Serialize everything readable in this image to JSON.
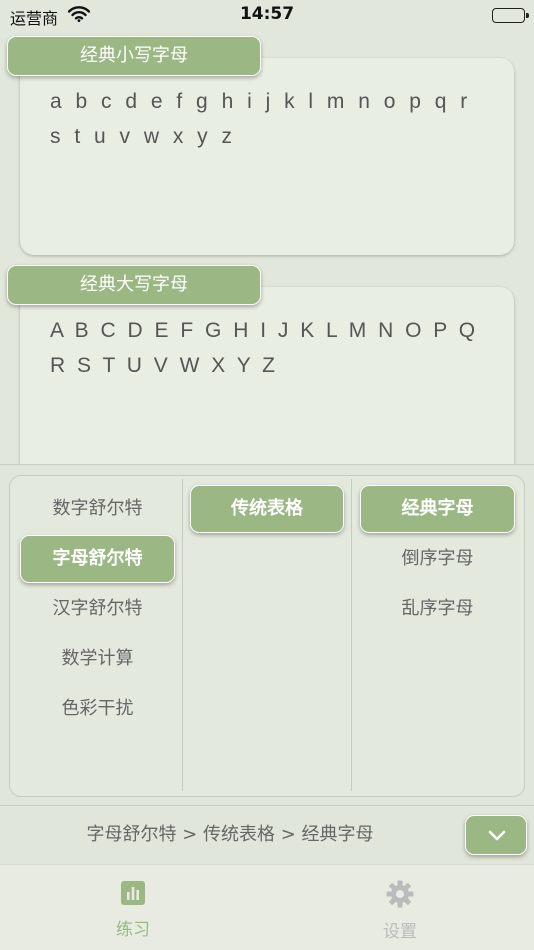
{
  "status_bar": {
    "carrier": "运营商",
    "time": "14:57"
  },
  "sections": [
    {
      "title": "经典小写字母",
      "letters": "a b c d e f g h i j k l m n o p q r s t u v w x y z"
    },
    {
      "title": "经典大写字母",
      "letters": "A B C D E F G H I J K L M N O P Q R S T U V W X Y Z"
    }
  ],
  "picker": {
    "col1": [
      "数字舒尔特",
      "字母舒尔特",
      "汉字舒尔特",
      "数学计算",
      "色彩干扰"
    ],
    "col2": [
      "传统表格"
    ],
    "col3": [
      "经典字母",
      "倒序字母",
      "乱序字母"
    ]
  },
  "breadcrumb": "字母舒尔特 > 传统表格 > 经典字母",
  "tabs": [
    {
      "label": "练习",
      "icon": "chart-icon",
      "active": true
    },
    {
      "label": "设置",
      "icon": "gear-icon",
      "active": false
    }
  ],
  "colors": {
    "accent": "#9bb884",
    "background": "#e1e7da",
    "text": "#555555"
  }
}
